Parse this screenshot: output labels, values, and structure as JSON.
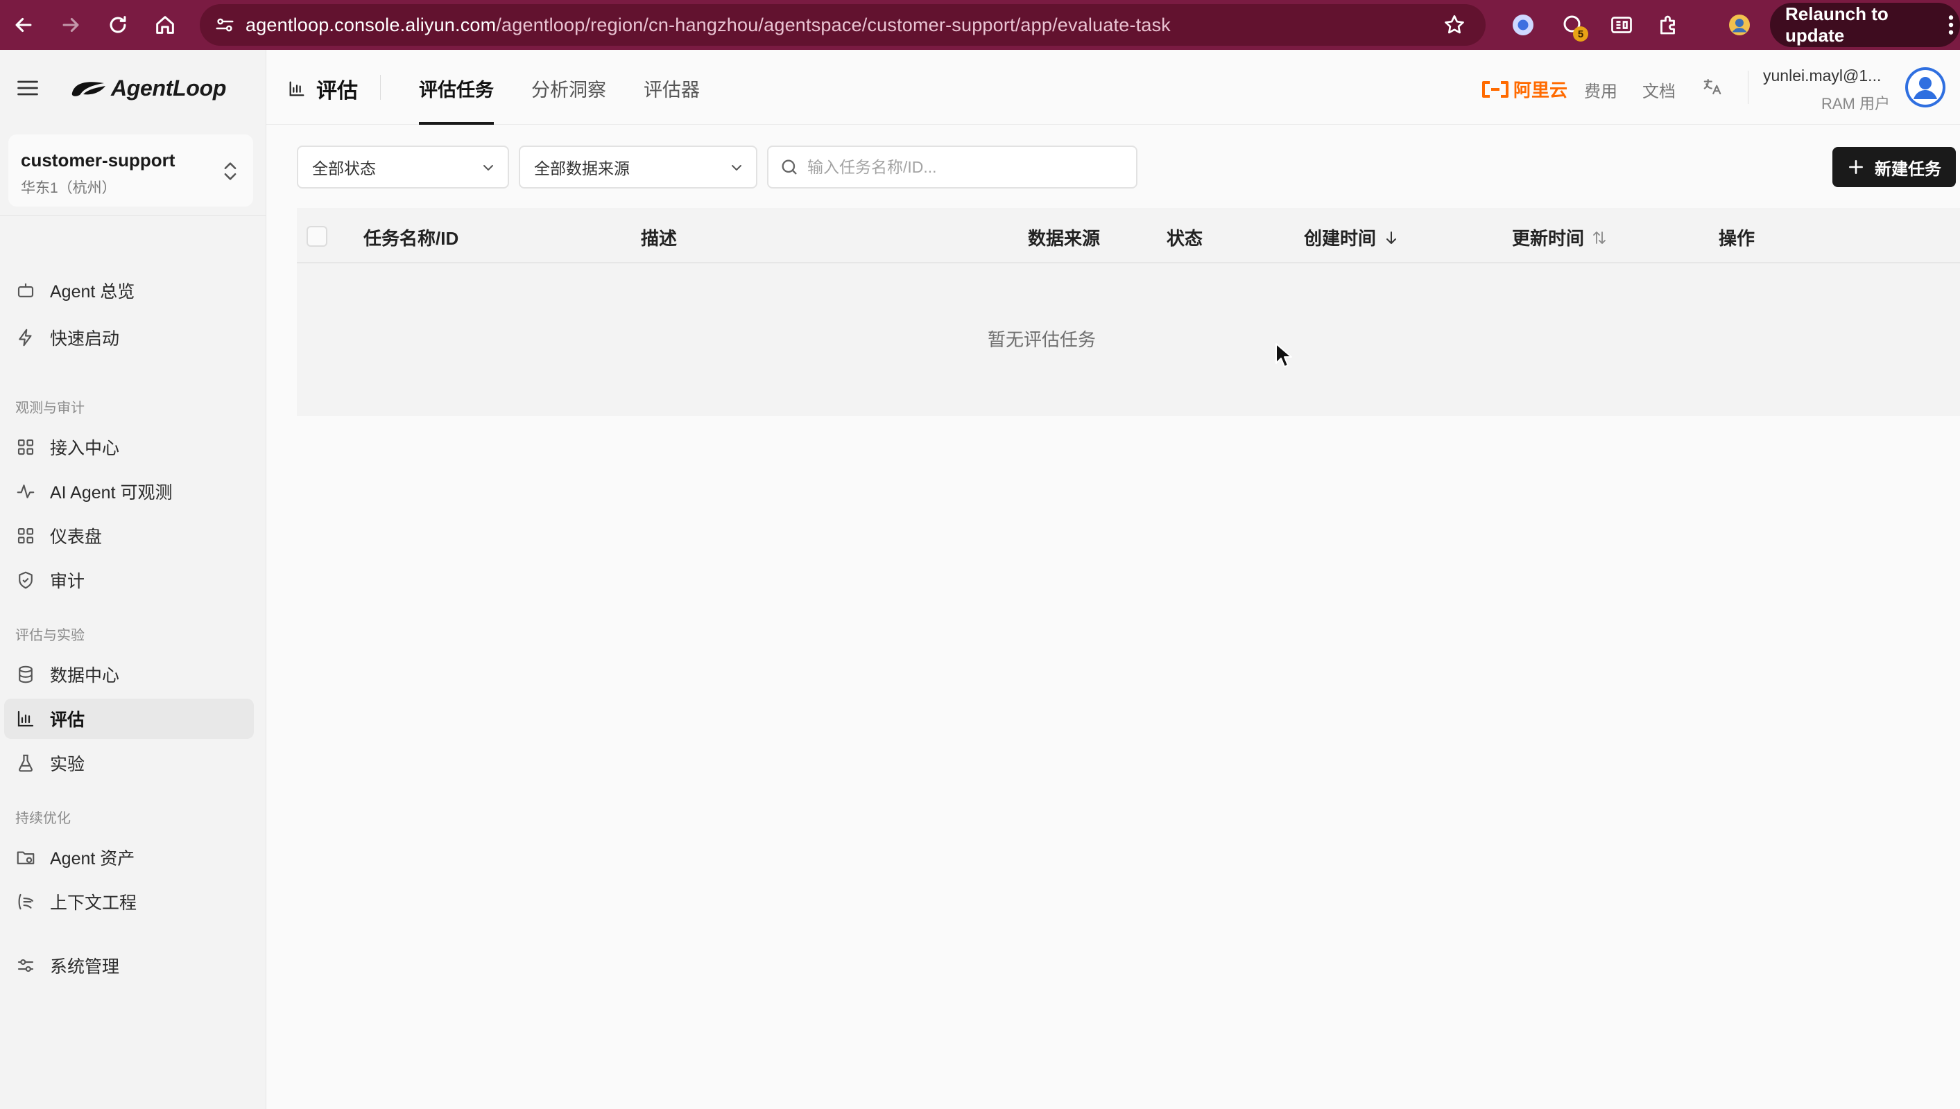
{
  "browser": {
    "url_host": "agentloop.console.aliyun.com",
    "url_path": "/agentloop/region/cn-hangzhou/agentspace/customer-support/app/evaluate-task",
    "extension_badge": "5",
    "relaunch_label": "Relaunch to update",
    "chrome_color": "#7a1b42"
  },
  "sidebar": {
    "logo_text": "AgentLoop",
    "project": {
      "name": "customer-support",
      "region": "华东1（杭州）"
    },
    "items": [
      {
        "id": "agent-overview",
        "label": "Agent 总览",
        "icon": "bot-icon"
      },
      {
        "id": "quick-start",
        "label": "快速启动",
        "icon": "bolt-icon"
      },
      {
        "section": "观测与审计"
      },
      {
        "id": "access-center",
        "label": "接入中心",
        "icon": "grid-icon"
      },
      {
        "id": "ai-agent-observability",
        "label": "AI Agent 可观测",
        "icon": "pulse-icon"
      },
      {
        "id": "dashboard",
        "label": "仪表盘",
        "icon": "grid-icon"
      },
      {
        "id": "audit",
        "label": "审计",
        "icon": "shield-icon"
      },
      {
        "section": "评估与实验"
      },
      {
        "id": "data-center",
        "label": "数据中心",
        "icon": "database-icon"
      },
      {
        "id": "evaluate",
        "label": "评估",
        "icon": "bar-chart-icon",
        "active": true
      },
      {
        "id": "experiment",
        "label": "实验",
        "icon": "flask-icon"
      },
      {
        "section": "持续优化"
      },
      {
        "id": "agent-assets",
        "label": "Agent 资产",
        "icon": "folder-icon"
      },
      {
        "id": "context-engineering",
        "label": "上下文工程",
        "icon": "context-icon"
      },
      {
        "id": "system-management",
        "label": "系统管理",
        "icon": "sliders-icon"
      }
    ]
  },
  "header": {
    "title": "评估",
    "tabs": [
      {
        "label": "评估任务",
        "active": true
      },
      {
        "label": "分析洞察",
        "active": false
      },
      {
        "label": "评估器",
        "active": false
      }
    ],
    "brand": "阿里云",
    "brand_color": "#ff6a00",
    "links": {
      "billing": "费用",
      "docs": "文档"
    },
    "user": {
      "name": "yunlei.mayl@1...",
      "role": "RAM 用户"
    }
  },
  "toolbar": {
    "status_filter": "全部状态",
    "source_filter": "全部数据来源",
    "search_placeholder": "输入任务名称/ID...",
    "search_value": "",
    "new_task_label": "新建任务"
  },
  "table": {
    "columns": [
      "任务名称/ID",
      "描述",
      "数据来源",
      "状态",
      "创建时间",
      "更新时间",
      "操作"
    ],
    "sort": {
      "创建时间": "desc",
      "更新时间": "sortable"
    },
    "rows": [],
    "empty_text": "暂无评估任务"
  }
}
